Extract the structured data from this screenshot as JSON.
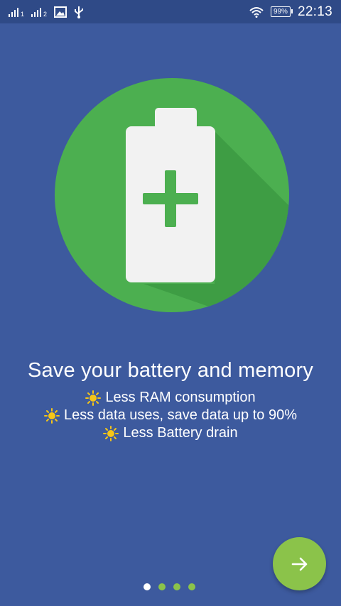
{
  "status_bar": {
    "sim1_label": "1",
    "sim2_label": "2",
    "icons": [
      "signal-icon",
      "signal-icon",
      "image-notification-icon",
      "usb-icon",
      "wifi-icon",
      "battery-icon"
    ],
    "battery_percent": "99%",
    "time": "22:13"
  },
  "hero": {
    "icon": "battery-plus-icon",
    "circle_color": "#4caf50",
    "battery_color": "#f2f2f2",
    "plus_color": "#4caf50"
  },
  "heading": "Save your battery and memory",
  "features": [
    {
      "icon": "sun-icon",
      "text": "Less RAM consumption"
    },
    {
      "icon": "sun-icon",
      "text": "Less data uses, save data up to 90%"
    },
    {
      "icon": "sun-icon",
      "text": "Less Battery drain"
    }
  ],
  "pager": {
    "total": 4,
    "active_index": 0
  },
  "next_button": {
    "icon": "arrow-right-icon",
    "color": "#8bc34a"
  },
  "colors": {
    "background": "#3d5a9e",
    "status_bar": "#2f4a87",
    "accent": "#8bc34a",
    "sun": "#f5c518"
  }
}
